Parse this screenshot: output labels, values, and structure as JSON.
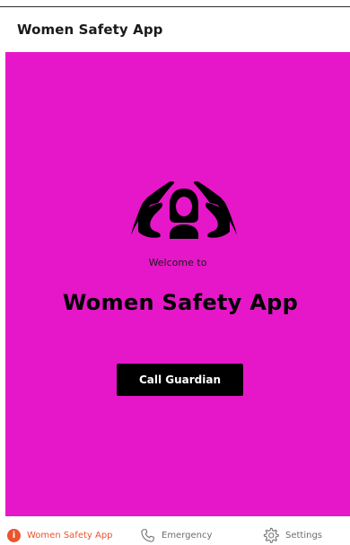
{
  "header": {
    "title": "Women Safety App"
  },
  "main": {
    "background_color": "#e617c8",
    "hero_icon": "protected-woman-icon",
    "welcome_text": "Welcome to",
    "app_title": "Women Safety App",
    "call_button_label": "Call Guardian"
  },
  "bottom_nav": {
    "items": [
      {
        "label": "Women Safety App",
        "icon": "info-icon",
        "active": true
      },
      {
        "label": "Emergency",
        "icon": "phone-icon",
        "active": false
      },
      {
        "label": "Settings",
        "icon": "gear-icon",
        "active": false
      }
    ],
    "active_color": "#e8552e"
  }
}
